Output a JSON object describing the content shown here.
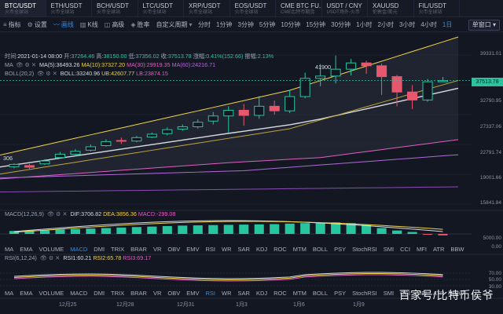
{
  "tabs": [
    {
      "name": "BTC/USDT",
      "sub": "火币全球站",
      "active": true
    },
    {
      "name": "ETH/USDT",
      "sub": "火币全球站",
      "active": false
    },
    {
      "name": "BCH/USDT",
      "sub": "火币全球站",
      "active": false
    },
    {
      "name": "LTC/USDT",
      "sub": "火币全球站",
      "active": false
    },
    {
      "name": "XRP/USDT",
      "sub": "火币全球站",
      "active": false
    },
    {
      "name": "EOS/USDT",
      "sub": "火币全球站",
      "active": false
    },
    {
      "name": "CME BTC FU...",
      "sub": "CME比特币期货",
      "active": false
    },
    {
      "name": "USDT / CNY",
      "sub": "USDT场外-火币",
      "active": false
    },
    {
      "name": "XAUUSD",
      "sub": "伦敦金/美元",
      "active": false
    },
    {
      "name": "FIL/USDT",
      "sub": "火币全球站",
      "active": false
    }
  ],
  "toolbar": {
    "tools": [
      {
        "icon": "≡",
        "label": "指标",
        "active": false,
        "name": "indicators"
      },
      {
        "icon": "⚙",
        "label": "设置",
        "active": false,
        "name": "settings"
      },
      {
        "icon": "〰",
        "label": "画线",
        "active": true,
        "name": "draw-line"
      },
      {
        "icon": "▥",
        "label": "K线",
        "active": false,
        "name": "kline"
      },
      {
        "icon": "◫",
        "label": "高级",
        "active": false,
        "name": "advanced"
      },
      {
        "icon": "◈",
        "label": "胜率",
        "active": false,
        "name": "win-rate"
      }
    ],
    "custom_period": "自定义周期",
    "timeframes": [
      {
        "label": "分时",
        "active": false
      },
      {
        "label": "1分钟",
        "active": false
      },
      {
        "label": "3分钟",
        "active": false
      },
      {
        "label": "5分钟",
        "active": false
      },
      {
        "label": "10分钟",
        "active": false
      },
      {
        "label": "15分钟",
        "active": false
      },
      {
        "label": "30分钟",
        "active": false
      },
      {
        "label": "1小时",
        "active": false
      },
      {
        "label": "2小时",
        "active": false
      },
      {
        "label": "3小时",
        "active": false
      },
      {
        "label": "4小时",
        "active": false
      },
      {
        "label": "1日",
        "active": true
      }
    ],
    "layout_label": "单窗口"
  },
  "ohlc": {
    "time_label": "时间:",
    "time": "2021-01-14 08:00",
    "open_label": "开:",
    "open": "37264.46",
    "high_label": "高:",
    "high": "38150.00",
    "low_label": "低:",
    "low": "37356.02",
    "close_label": "收:",
    "close": "37513.78",
    "change_label": "涨幅:",
    "change": "0.41%(152.66)",
    "amp_label": "振幅:",
    "amp": "2.13%"
  },
  "ma_line": {
    "title": "MA",
    "ma5": "MA(5):36493.26",
    "ma10": "MA(10):37327.20",
    "ma30": "MA(30):29919.35",
    "ma60": "MA(60):24216.71"
  },
  "boll_line": {
    "title": "BOLL(20,2)",
    "boll": "BOLL:33240.96",
    "ub": "UB:42607.77",
    "lb": "LB:23874.15"
  },
  "price_axis": [
    "39331.01",
    "32790.95",
    "27337.06",
    "22791.74",
    "19001.66",
    "15841.84"
  ],
  "current_price": "37513.78",
  "peak_label": "41900",
  "low_label_left": "306",
  "macd": {
    "title": "MACD(12,26,9)",
    "dif": "DIF:3706.82",
    "dea": "DEA:3856.36",
    "macd": "MACD:-299.08",
    "axis": [
      "5000.00",
      "0.00"
    ]
  },
  "indicator_tabs": [
    "MA",
    "EMA",
    "VOLUME",
    "MACD",
    "DMI",
    "TRIX",
    "BRAR",
    "VR",
    "OBV",
    "EMV",
    "RSI",
    "WR",
    "SAR",
    "KDJ",
    "ROC",
    "MTM",
    "BOLL",
    "PSY",
    "StochRSI",
    "SMI",
    "CCI",
    "MFI",
    "ATR",
    "BBW"
  ],
  "active_indicator_top": "MACD",
  "active_indicator_bottom": "RSI",
  "rsi": {
    "title": "RSI(6,12,24)",
    "rsi1": "RSI1:60.21",
    "rsi2": "RSI2:65.78",
    "rsi3": "RSI3:69.17",
    "axis": [
      "70.00",
      "50.00",
      "30.00"
    ]
  },
  "dates": [
    "12月25",
    "12月28",
    "12月31",
    "1月3",
    "1月6",
    "1月9"
  ],
  "watermark": "百家号/比特币侯爷",
  "colors": {
    "up": "#26c6a0",
    "down": "#e8576d",
    "accent": "#2d8ce8",
    "ma5": "#d7dbe3",
    "ma10": "#f0d347",
    "ma30": "#e05fc4",
    "ma60": "#b06ad8"
  },
  "chart_data": {
    "type": "candlestick",
    "candles": [
      {
        "o": 22400,
        "c": 22800,
        "h": 23000,
        "l": 22100
      },
      {
        "o": 22600,
        "c": 22300,
        "h": 22900,
        "l": 22000
      },
      {
        "o": 22900,
        "c": 23400,
        "h": 23700,
        "l": 22700
      },
      {
        "o": 24000,
        "c": 24600,
        "h": 25000,
        "l": 23800
      },
      {
        "o": 24600,
        "c": 25100,
        "h": 25500,
        "l": 24300
      },
      {
        "o": 25300,
        "c": 25900,
        "h": 26300,
        "l": 25100
      },
      {
        "o": 26100,
        "c": 26800,
        "h": 27200,
        "l": 25900
      },
      {
        "o": 27000,
        "c": 26900,
        "h": 27500,
        "l": 26400
      },
      {
        "o": 26900,
        "c": 27500,
        "h": 27800,
        "l": 26700
      },
      {
        "o": 27600,
        "c": 28100,
        "h": 28400,
        "l": 27400
      },
      {
        "o": 28200,
        "c": 28900,
        "h": 29300,
        "l": 27900
      },
      {
        "o": 29000,
        "c": 29400,
        "h": 29800,
        "l": 28700
      },
      {
        "o": 29400,
        "c": 30200,
        "h": 30700,
        "l": 29100
      },
      {
        "o": 30400,
        "c": 31300,
        "h": 32000,
        "l": 29800
      },
      {
        "o": 31300,
        "c": 32300,
        "h": 33000,
        "l": 28400
      },
      {
        "o": 32300,
        "c": 31400,
        "h": 33400,
        "l": 29600
      },
      {
        "o": 31400,
        "c": 33000,
        "h": 34800,
        "l": 30800
      },
      {
        "o": 33000,
        "c": 32200,
        "h": 34000,
        "l": 31500
      },
      {
        "o": 32200,
        "c": 34700,
        "h": 35900,
        "l": 31800
      },
      {
        "o": 34700,
        "c": 37900,
        "h": 38900,
        "l": 34400
      },
      {
        "o": 37900,
        "c": 38300,
        "h": 40400,
        "l": 36500
      },
      {
        "o": 38300,
        "c": 39500,
        "h": 41900,
        "l": 37000
      },
      {
        "o": 39500,
        "c": 40600,
        "h": 41300,
        "l": 38400
      },
      {
        "o": 40600,
        "c": 40100,
        "h": 41000,
        "l": 38700
      },
      {
        "o": 40100,
        "c": 38200,
        "h": 40500,
        "l": 35000
      },
      {
        "o": 38200,
        "c": 35500,
        "h": 38500,
        "l": 33000
      },
      {
        "o": 35500,
        "c": 34100,
        "h": 36700,
        "l": 32500
      },
      {
        "o": 34100,
        "c": 37300,
        "h": 37800,
        "l": 33800
      },
      {
        "o": 37300,
        "c": 37500,
        "h": 38150,
        "l": 37350
      }
    ],
    "ylim": [
      15841,
      42000
    ],
    "macd_hist": [
      600,
      700,
      800,
      900,
      1000,
      1100,
      1200,
      1300,
      1400,
      1500,
      1600,
      1700,
      1750,
      1800,
      1850,
      1900,
      1950,
      2000,
      2100,
      2200,
      2300,
      2350,
      2200,
      1900,
      1200,
      700,
      400,
      -100,
      -299
    ]
  }
}
